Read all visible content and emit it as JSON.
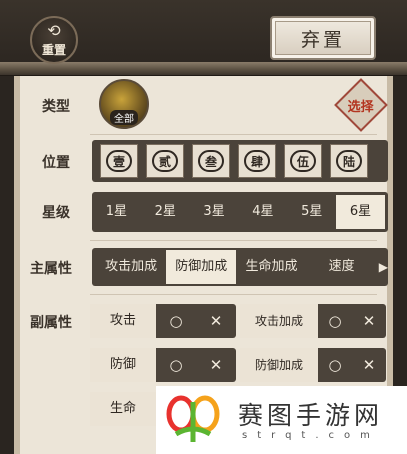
{
  "header": {
    "reset_label": "重置",
    "discard_label": "弃置"
  },
  "filters": {
    "type": {
      "label": "类型",
      "value_tag": "全部",
      "select_label": "选择"
    },
    "position": {
      "label": "位置",
      "slots": [
        "壹",
        "贰",
        "叁",
        "肆",
        "伍",
        "陆"
      ]
    },
    "star": {
      "label": "星级",
      "options": [
        "1星",
        "2星",
        "3星",
        "4星",
        "5星",
        "6星"
      ],
      "selected": "6星"
    },
    "main_attr": {
      "label": "主属性",
      "options": [
        "攻击加成",
        "防御加成",
        "生命加成",
        "速度"
      ],
      "selected": "防御加成"
    },
    "sub_attr": {
      "label": "副属性",
      "items": [
        {
          "name": "攻击",
          "yes": "○",
          "no": "✕"
        },
        {
          "name": "攻击加成",
          "yes": "○",
          "no": "✕"
        },
        {
          "name": "防御",
          "yes": "○",
          "no": "✕"
        },
        {
          "name": "防御加成",
          "yes": "○",
          "no": "✕"
        },
        {
          "name": "生命",
          "yes": "○",
          "no": "✕"
        }
      ]
    }
  },
  "watermark": {
    "text": "赛图手游网",
    "sub": "strqt.com"
  }
}
